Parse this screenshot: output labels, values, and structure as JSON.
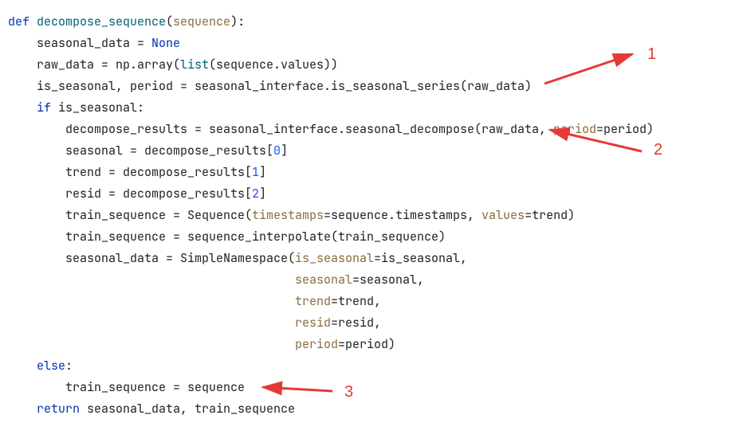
{
  "annotations": {
    "a1": "1",
    "a2": "2",
    "a3": "3"
  },
  "code": {
    "l1": {
      "def": "def ",
      "name": "decompose_sequence",
      "paren_open": "(",
      "param": "sequence",
      "paren_close": "):"
    },
    "l2": {
      "pre": "    seasonal_data = ",
      "none": "None"
    },
    "l3": {
      "pre": "    raw_data = np.array(",
      "list": "list",
      "post": "(sequence.values))"
    },
    "l4": {
      "text": "    is_seasonal, period = seasonal_interface.is_seasonal_series(raw_data)"
    },
    "l5": {
      "if": "    if ",
      "cond": "is_seasonal:"
    },
    "l6": {
      "pre": "        decompose_results = seasonal_interface.seasonal_decompose(raw_data, ",
      "kw": "period",
      "post": "=period)"
    },
    "l7": {
      "pre": "        seasonal = decompose_results[",
      "num": "0",
      "post": "]"
    },
    "l8": {
      "pre": "        trend = decompose_results[",
      "num": "1",
      "post": "]"
    },
    "l9": {
      "pre": "        resid = decompose_results[",
      "num": "2",
      "post": "]"
    },
    "l10": {
      "pre": "        train_sequence = Sequence(",
      "kw1": "timestamps",
      "mid": "=sequence.timestamps, ",
      "kw2": "values",
      "post": "=trend)"
    },
    "l11": {
      "text": "        train_sequence = sequence_interpolate(train_sequence)"
    },
    "l12": {
      "pre": "        seasonal_data = SimpleNamespace(",
      "kw": "is_seasonal",
      "post": "=is_seasonal,"
    },
    "l13": {
      "pre": "                                        ",
      "kw": "seasonal",
      "post": "=seasonal,"
    },
    "l14": {
      "pre": "                                        ",
      "kw": "trend",
      "post": "=trend,"
    },
    "l15": {
      "pre": "                                        ",
      "kw": "resid",
      "post": "=resid,"
    },
    "l16": {
      "pre": "                                        ",
      "kw": "period",
      "post": "=period)"
    },
    "l17": {
      "else": "    else",
      "colon": ":"
    },
    "l18": {
      "text": "        train_sequence = sequence"
    },
    "l19": {
      "ret": "    return ",
      "vals": "seasonal_data, train_sequence"
    }
  }
}
